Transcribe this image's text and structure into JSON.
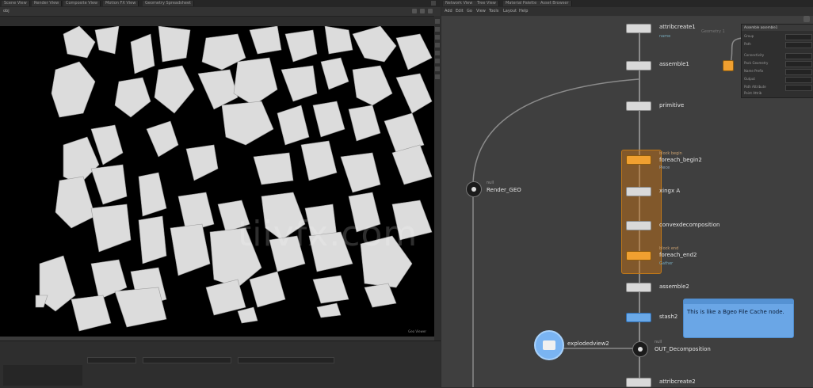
{
  "left_tabs": [
    "Scene View",
    "Render View",
    "Composite View",
    "Motion FX View",
    "Geometry Spreadsheet"
  ],
  "left_path": "obj",
  "right_tabs": [
    "Network View",
    "Tree View",
    "Material Palette",
    "Asset Browser"
  ],
  "right_path": "obj",
  "right_menu": [
    "Add",
    "Edit",
    "Go",
    "View",
    "Tools",
    "Layout",
    "Help"
  ],
  "nodes": {
    "attribcreate1": {
      "label": "attribcreate1",
      "sub": "name"
    },
    "assemble1": {
      "label": "assemble1"
    },
    "primitive": {
      "label": "primitive"
    },
    "foreach_begin2": {
      "label": "foreach_begin2",
      "sub": "Piece",
      "tag": "block begin"
    },
    "xform": {
      "label": "xingx A"
    },
    "convexdecomposition": {
      "label": "convexdecomposition"
    },
    "foreach_end2": {
      "label": "foreach_end2",
      "sub": "Gather",
      "tag": "block end"
    },
    "assemble2": {
      "label": "assemble2"
    },
    "stash2": {
      "label": "stash2"
    },
    "render_geo": {
      "label": "Render_GEO",
      "tag": "null"
    },
    "explodedview2": {
      "label": "explodedview2"
    },
    "out_decomposition": {
      "label": "OUT_Decomposition",
      "tag": "null"
    },
    "attribcreate2": {
      "label": "attribcreate2"
    },
    "geometry_label": {
      "label": "Geometry 1"
    }
  },
  "note": {
    "text": "This is like a Bgeo File Cache node."
  },
  "params": {
    "header": "Assemble  assemble1",
    "rows": [
      "Group",
      "Path",
      "Connectivity",
      "Pack Geometry",
      "Name Prefix",
      "Output",
      "Path Attribute",
      "Point Attrib"
    ]
  },
  "watermark": "tiivfx.com",
  "viewport_label": "Geo Viewer"
}
